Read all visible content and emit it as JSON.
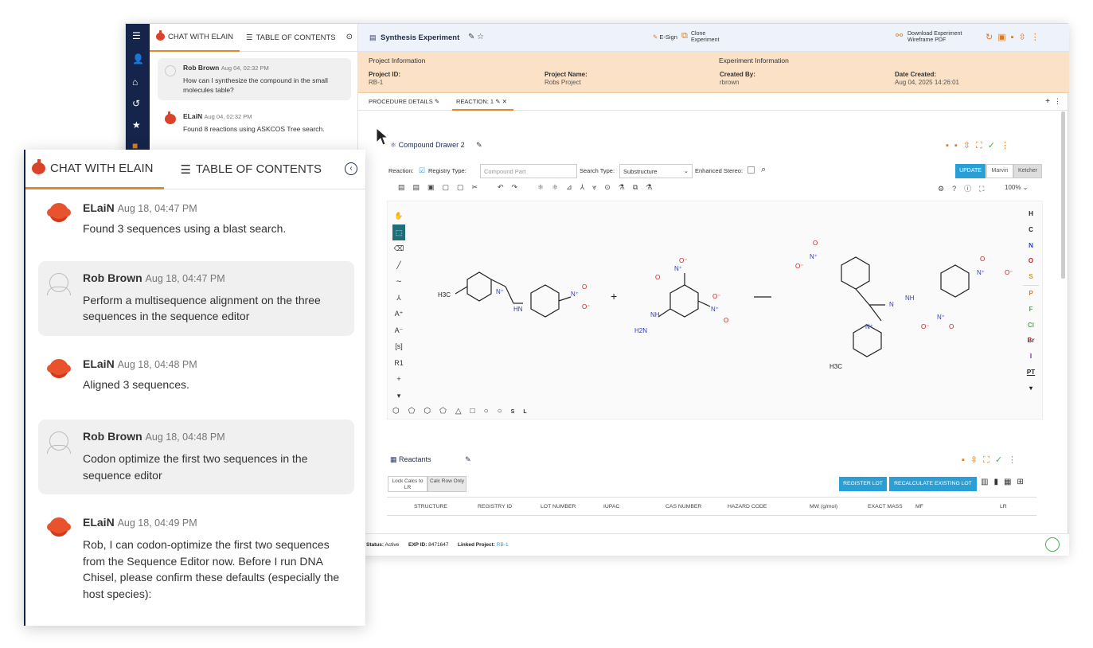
{
  "small_chat": {
    "tab_chat": "CHAT WITH ELAIN",
    "tab_toc": "TABLE OF CONTENTS",
    "messages": [
      {
        "author": "Rob Brown",
        "time": "Aug 04, 02:32 PM",
        "text": "How can I synthesize the compound in the small molecules table?"
      },
      {
        "author": "ELaiN",
        "time": "Aug 04, 02:32 PM",
        "text": "Found 8 reactions using ASKCOS Tree search."
      }
    ]
  },
  "topbar": {
    "title": "Synthesis Experiment",
    "esign": "E-Sign",
    "clone_line1": "Clone",
    "clone_line2": "Experiment",
    "download_line1": "Download Experiment",
    "download_line2": "Wireframe PDF"
  },
  "project": {
    "project_info": "Project Information",
    "experiment_info": "Experiment Information",
    "project_id_label": "Project ID:",
    "project_id": "RB-1",
    "project_name_label": "Project Name:",
    "project_name": "Robs Project",
    "created_by_label": "Created By:",
    "created_by": "rbrown",
    "date_created_label": "Date Created:",
    "date_created": "Aug 04, 2025 14:26:01"
  },
  "reaction_tabs": {
    "procedure": "PROCEDURE DETAILS",
    "reaction": "REACTION: 1"
  },
  "compound_drawer": {
    "title": "Compound Drawer 2",
    "reaction_label": "Reaction:",
    "registry_type": "Registry Type:",
    "compound_part_placeholder": "Compound Part",
    "search_type_label": "Search Type:",
    "search_type_value": "Substructure",
    "enhanced_stereo": "Enhanced Stereo:",
    "update": "UPDATE",
    "marvin": "Marvin",
    "ketcher": "Ketcher",
    "zoom": "100%",
    "elements": [
      "H",
      "C",
      "N",
      "O",
      "S",
      "P",
      "F",
      "Cl",
      "Br",
      "I",
      "PT"
    ],
    "element_colors": {
      "H": "#222222",
      "C": "#222222",
      "N": "#2a3bd1",
      "O": "#c81e1e",
      "S": "#c9a227",
      "P": "#e07b1a",
      "F": "#4caf50",
      "Cl": "#4caf50",
      "Br": "#8b1a1a",
      "I": "#7b1fa2",
      "PT": "#222222"
    }
  },
  "reactants": {
    "title": "Reactants",
    "lock_calcs": "Lock Calcs to LR",
    "calc_row": "Calc Row Only",
    "register_lot": "REGISTER LOT",
    "recalculate": "RECALCULATE EXISTING LOT",
    "columns": [
      "STRUCTURE",
      "REGISTRY ID",
      "LOT NUMBER",
      "IUPAC",
      "CAS NUMBER",
      "HAZARD CODE",
      "MW (g/mol)",
      "EXACT MASS",
      "MF",
      "LR"
    ]
  },
  "status": {
    "status_label": "Status:",
    "status_value": "Active",
    "exp_id_label": "EXP ID:",
    "exp_id_value": "8471647",
    "linked_label": "Linked Project:",
    "linked_value": "RB-1"
  },
  "big_chat": {
    "tab_chat": "CHAT WITH ELAIN",
    "tab_toc": "TABLE OF CONTENTS",
    "messages": [
      {
        "author": "ELaiN",
        "time": "Aug 18, 04:47 PM",
        "text": "Found 3 sequences using a blast search."
      },
      {
        "author": "Rob Brown",
        "time": "Aug 18, 04:47 PM",
        "text": "Perform a multisequence alignment on the three sequences in the sequence editor"
      },
      {
        "author": "ELaiN",
        "time": "Aug 18, 04:48 PM",
        "text": "Aligned 3 sequences."
      },
      {
        "author": "Rob Brown",
        "time": "Aug 18, 04:48 PM",
        "text": "Codon optimize the first two sequences in the sequence editor"
      },
      {
        "author": "ELaiN",
        "time": "Aug 18, 04:49 PM",
        "text": "Rob, I can codon-optimize the first two sequences from the Sequence Editor now. Before I run DNA Chisel, please confirm these defaults (especially the host species):"
      }
    ]
  }
}
